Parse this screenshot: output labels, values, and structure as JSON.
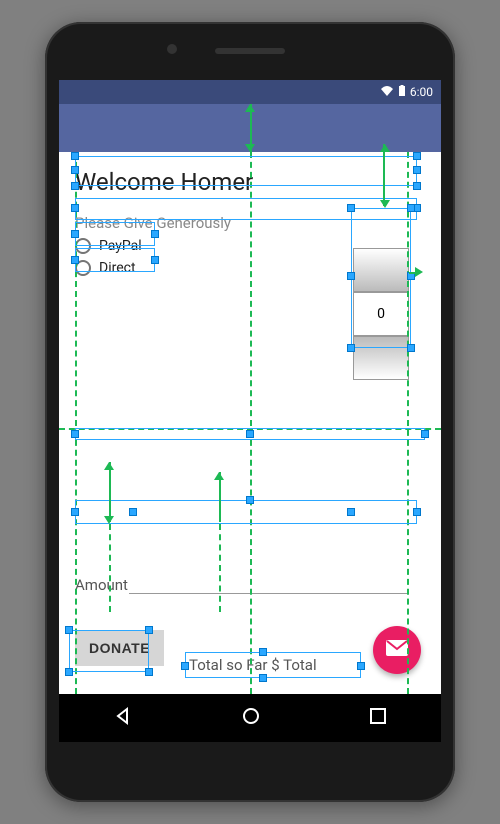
{
  "status_bar": {
    "time": "6:00"
  },
  "content": {
    "title": "Welcome Homer",
    "subtitle": "Please Give Generously",
    "radio1": "PayPal",
    "radio2": "Direct",
    "picker_value": "0",
    "amount_label": "Amount",
    "donate_button": "DONATE",
    "total_label": "Total so Far $ Total"
  }
}
